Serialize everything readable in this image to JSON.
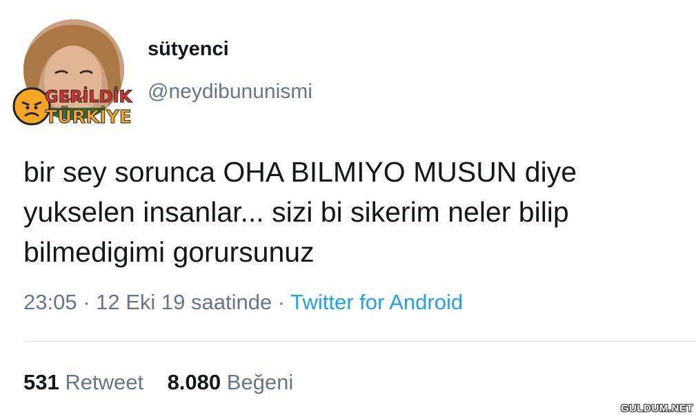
{
  "user": {
    "display_name": "sütyenci",
    "handle": "@neydibununismi"
  },
  "watermark": {
    "line1": "GERİLDİK",
    "line2": "TÜRKİYE",
    "site": "GULDUM.NET"
  },
  "tweet": {
    "text": "bir sey sorunca OHA BILMIYO MUSUN diye\nyukselen insanlar... sizi bi sikerim neler bilip\nbilmedigimi gorursunuz",
    "time": "23:05",
    "date": "12 Eki 19 saatinde",
    "separator": "·",
    "source": "Twitter for Android"
  },
  "stats": {
    "retweets_count": "531",
    "retweets_label": "Retweet",
    "likes_count": "8.080",
    "likes_label": "Beğeni"
  },
  "colors": {
    "text": "#14171a",
    "secondary": "#657786",
    "link": "#1da1f2",
    "divider": "#e1e8ed",
    "logo_red": "#e0332b",
    "logo_orange": "#f5a623"
  }
}
